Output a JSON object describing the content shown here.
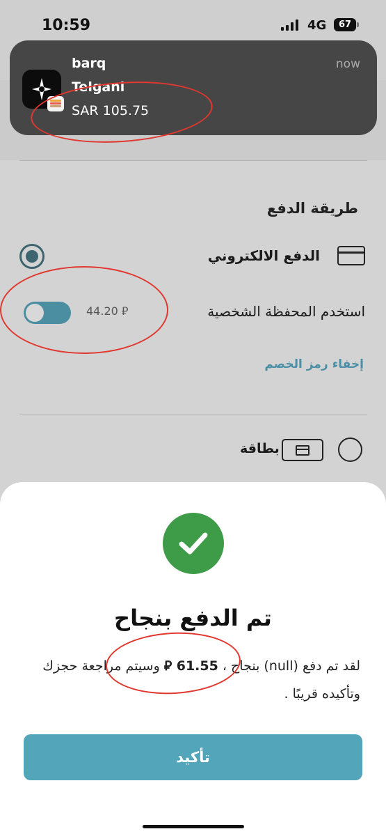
{
  "status_bar": {
    "time": "10:59",
    "network": "4G",
    "battery": "67"
  },
  "notification": {
    "app_name": "barq",
    "title": "Telgani",
    "body": "SAR 105.75",
    "time": "now",
    "app_icon": "sparkle-icon",
    "badge_icon": "wallet-icon"
  },
  "payment": {
    "section_title": "طريقة الدفع",
    "electronic_label": "الدفع الالكتروني",
    "electronic_icon": "credit-card-icon",
    "wallet_label": "استخدم المحفظة الشخصية",
    "wallet_amount": "44.20 ⃁",
    "wallet_toggle_on": true,
    "hide_discount_label": "إخفاء رمز الخصم",
    "card_label": "بطاقة",
    "card_icon": "card-icon"
  },
  "modal": {
    "icon": "check-icon",
    "title": "تم الدفع بنجاح",
    "message_prefix": "لقد تم دفع (null) بنجاح ،",
    "message_amount": "61.55 ⃁",
    "message_suffix": "وسيتم مراجعة حجزك وتأكيده قريبًا .",
    "confirm_label": "تأكيد"
  },
  "colors": {
    "accent": "#53a5ba",
    "success": "#3e9b48",
    "annotation": "#e0382f"
  }
}
